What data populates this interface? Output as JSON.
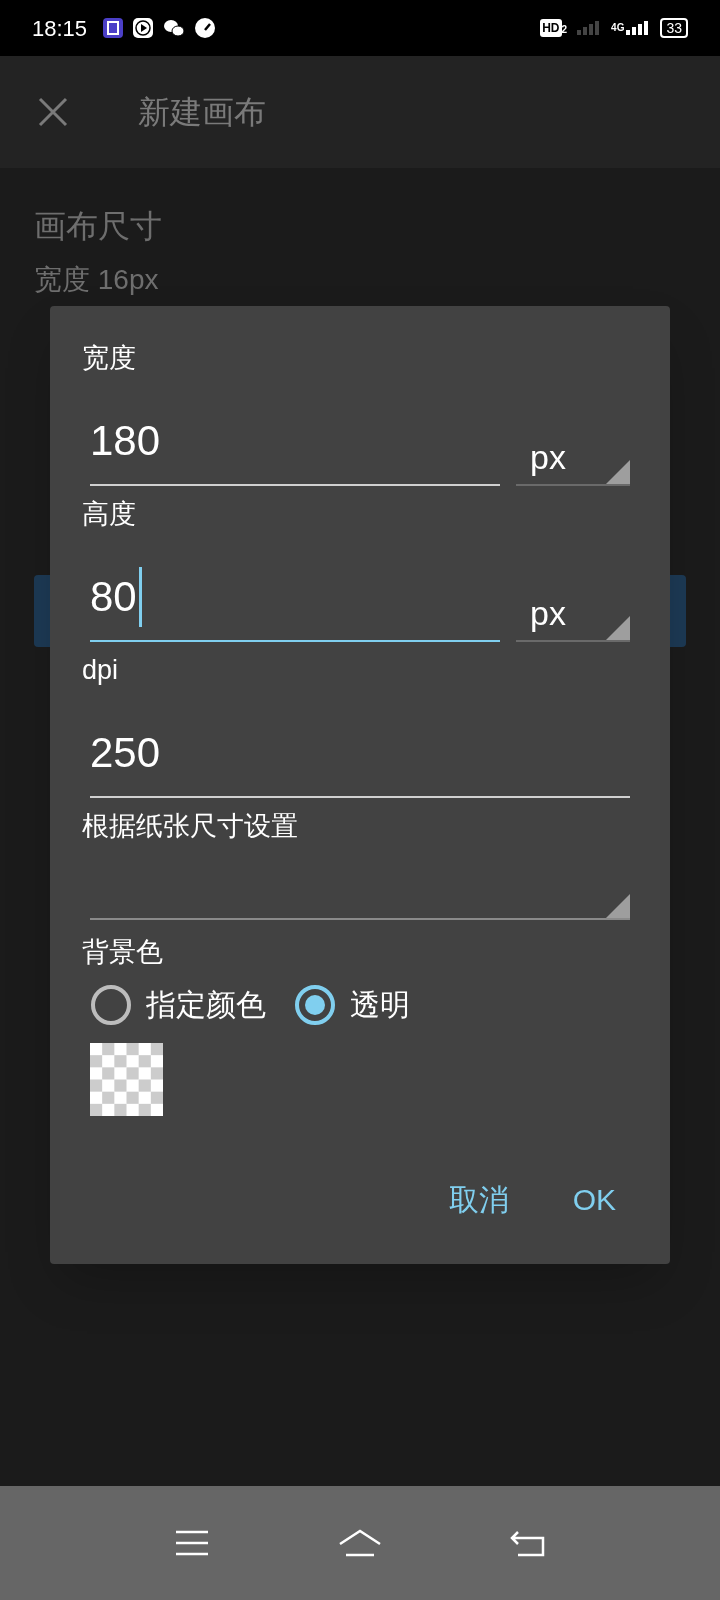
{
  "status_bar": {
    "time": "18:15",
    "hd_badge": "HD",
    "hd_sub": "2",
    "network": "4G",
    "battery": "33"
  },
  "app_bar": {
    "title": "新建画布"
  },
  "background": {
    "section_title": "画布尺寸",
    "rows": [
      "宽度 16px"
    ]
  },
  "dialog": {
    "fields": [
      {
        "kind": "number_unit",
        "label": "宽度",
        "value": "180",
        "unit": "px",
        "focused": false
      },
      {
        "kind": "number_unit",
        "label": "高度",
        "value": "80",
        "unit": "px",
        "focused": true
      },
      {
        "kind": "number",
        "label": "dpi",
        "value": "250",
        "focused": false
      },
      {
        "kind": "dropdown",
        "label": "根据纸张尺寸设置"
      }
    ],
    "background_color": {
      "label": "背景色",
      "options": [
        {
          "label": "指定颜色",
          "selected": false
        },
        {
          "label": "透明",
          "selected": true
        }
      ]
    },
    "buttons": [
      {
        "label": "取消"
      },
      {
        "label": "OK"
      }
    ]
  }
}
